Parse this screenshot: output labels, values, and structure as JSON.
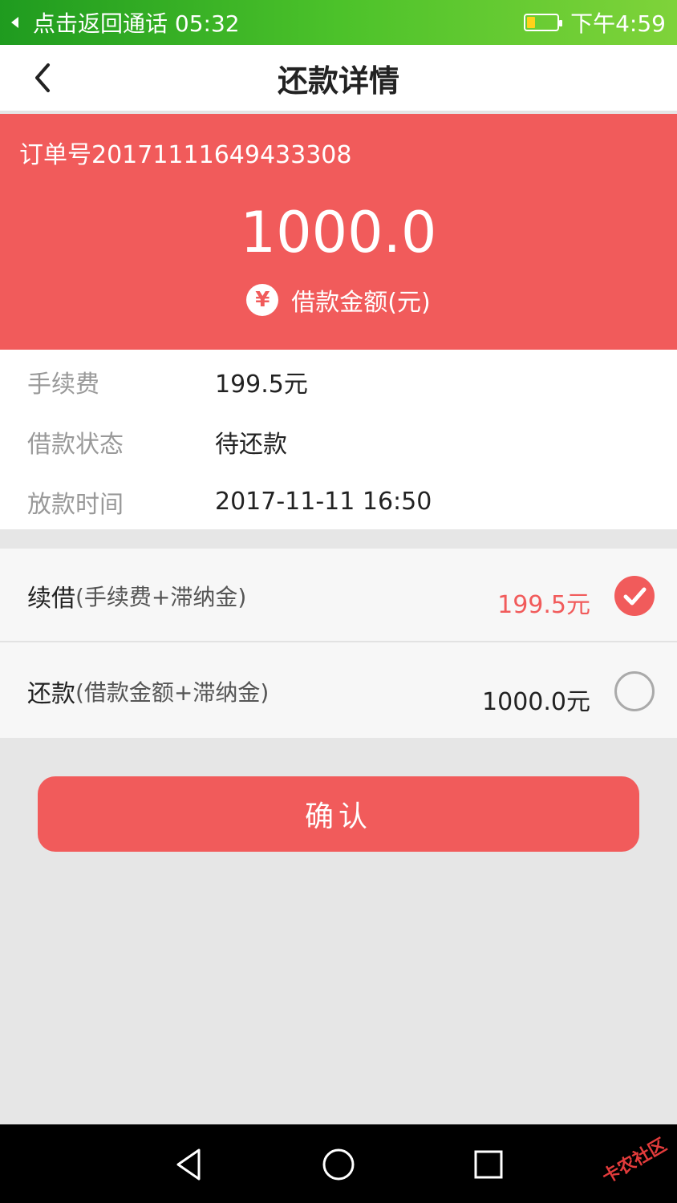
{
  "status_bar": {
    "call_text": "点击返回通话 05:32",
    "time": "下午4:59",
    "battery_level": 0.25,
    "battery_color": "#ffd21a"
  },
  "nav": {
    "title": "还款详情"
  },
  "hero": {
    "order_no": "订单号20171111649433308",
    "amount": "1000.0",
    "amount_label": "借款金额(元)",
    "yen_symbol": "¥",
    "bg_color": "#f15b5b"
  },
  "info": {
    "rows": [
      {
        "label": "手续费",
        "value": "199.5元"
      },
      {
        "label": "借款状态",
        "value": "待还款"
      },
      {
        "label": "放款时间",
        "value": "2017-11-11 16:50"
      }
    ]
  },
  "options": [
    {
      "title": "续借",
      "sub": "(手续费+滞纳金)",
      "amount": "199.5元",
      "selected": true
    },
    {
      "title": "还款",
      "sub": "(借款金额+滞纳金)",
      "amount": "1000.0元",
      "selected": false
    }
  ],
  "confirm_label": "确认",
  "watermark": "卡农社区",
  "icons": {
    "back": "chevron-left-icon",
    "yen": "yen-icon",
    "check": "check-circle-icon",
    "radio": "radio-empty-icon",
    "nav_back": "triangle-back-icon",
    "nav_home": "circle-home-icon",
    "nav_recent": "square-recent-icon"
  }
}
